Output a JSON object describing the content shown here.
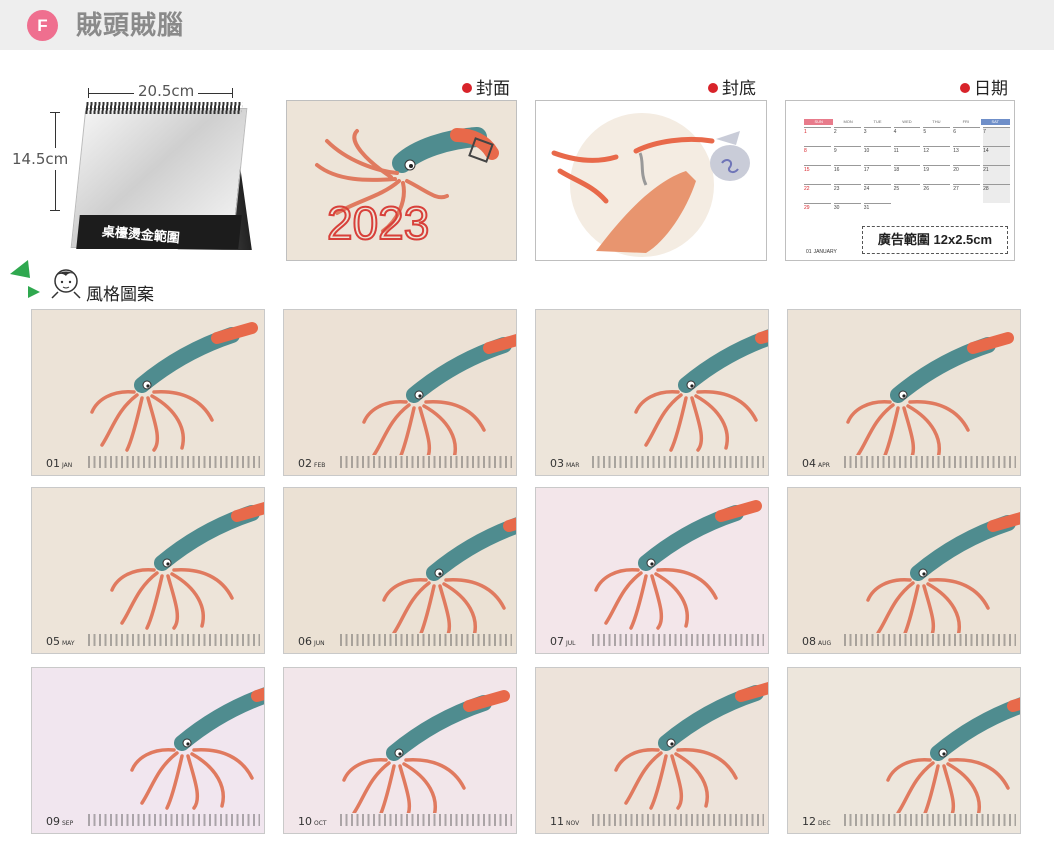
{
  "header": {
    "badge": "F",
    "title": "賊頭賊腦"
  },
  "mockup": {
    "width_label": "20.5cm",
    "height_label": "14.5cm",
    "band_text": "桌檯燙金範圍"
  },
  "previews": {
    "cover_label": "封面",
    "back_label": "封底",
    "date_label": "日期",
    "ad_label": "廣告範圍 12x2.5cm",
    "date_month_num": "01",
    "date_month_name": "JANUARY",
    "weekdays": [
      "SUN",
      "MON",
      "TUE",
      "WED",
      "THU",
      "FRI",
      "SAT"
    ],
    "days": [
      "1",
      "2",
      "3",
      "4",
      "5",
      "6",
      "7",
      "8",
      "9",
      "10",
      "11",
      "12",
      "13",
      "14",
      "15",
      "16",
      "17",
      "18",
      "19",
      "20",
      "21",
      "22",
      "23",
      "24",
      "25",
      "26",
      "27",
      "28",
      "29",
      "30",
      "31"
    ]
  },
  "style_section": {
    "title": "風格圖案"
  },
  "months": [
    {
      "num": "01",
      "abbr": "JAN"
    },
    {
      "num": "02",
      "abbr": "FEB"
    },
    {
      "num": "03",
      "abbr": "MAR"
    },
    {
      "num": "04",
      "abbr": "APR"
    },
    {
      "num": "05",
      "abbr": "MAY"
    },
    {
      "num": "06",
      "abbr": "JUN"
    },
    {
      "num": "07",
      "abbr": "JUL"
    },
    {
      "num": "08",
      "abbr": "AUG"
    },
    {
      "num": "09",
      "abbr": "SEP"
    },
    {
      "num": "10",
      "abbr": "OCT"
    },
    {
      "num": "11",
      "abbr": "NOV"
    },
    {
      "num": "12",
      "abbr": "DEC"
    }
  ],
  "cover_year": "2023",
  "colors": {
    "badge": "#ef6f8f",
    "squid_body": "#4f8c8f",
    "squid_tip": "#e8694a",
    "tentacle": "#e07a5f",
    "dot": "#d8232a",
    "paper": "#ede4d8"
  },
  "icons": {
    "mascot": "girl-face-icon",
    "triangle": "green-triangle-icon"
  }
}
